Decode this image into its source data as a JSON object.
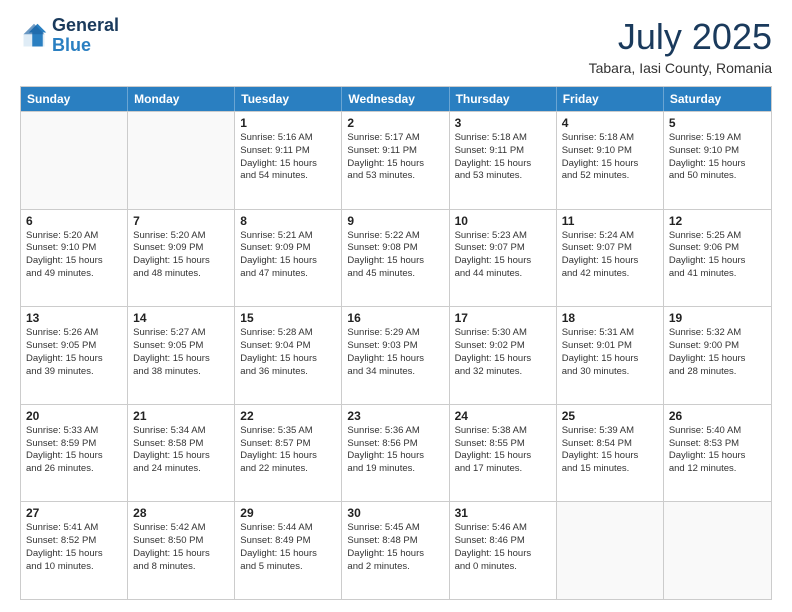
{
  "header": {
    "logo_general": "General",
    "logo_blue": "Blue",
    "month_title": "July 2025",
    "location": "Tabara, Iasi County, Romania"
  },
  "calendar": {
    "days_of_week": [
      "Sunday",
      "Monday",
      "Tuesday",
      "Wednesday",
      "Thursday",
      "Friday",
      "Saturday"
    ],
    "rows": [
      [
        {
          "day": "",
          "empty": true
        },
        {
          "day": "",
          "empty": true
        },
        {
          "day": "1",
          "line1": "Sunrise: 5:16 AM",
          "line2": "Sunset: 9:11 PM",
          "line3": "Daylight: 15 hours",
          "line4": "and 54 minutes."
        },
        {
          "day": "2",
          "line1": "Sunrise: 5:17 AM",
          "line2": "Sunset: 9:11 PM",
          "line3": "Daylight: 15 hours",
          "line4": "and 53 minutes."
        },
        {
          "day": "3",
          "line1": "Sunrise: 5:18 AM",
          "line2": "Sunset: 9:11 PM",
          "line3": "Daylight: 15 hours",
          "line4": "and 53 minutes."
        },
        {
          "day": "4",
          "line1": "Sunrise: 5:18 AM",
          "line2": "Sunset: 9:10 PM",
          "line3": "Daylight: 15 hours",
          "line4": "and 52 minutes."
        },
        {
          "day": "5",
          "line1": "Sunrise: 5:19 AM",
          "line2": "Sunset: 9:10 PM",
          "line3": "Daylight: 15 hours",
          "line4": "and 50 minutes."
        }
      ],
      [
        {
          "day": "6",
          "line1": "Sunrise: 5:20 AM",
          "line2": "Sunset: 9:10 PM",
          "line3": "Daylight: 15 hours",
          "line4": "and 49 minutes."
        },
        {
          "day": "7",
          "line1": "Sunrise: 5:20 AM",
          "line2": "Sunset: 9:09 PM",
          "line3": "Daylight: 15 hours",
          "line4": "and 48 minutes."
        },
        {
          "day": "8",
          "line1": "Sunrise: 5:21 AM",
          "line2": "Sunset: 9:09 PM",
          "line3": "Daylight: 15 hours",
          "line4": "and 47 minutes."
        },
        {
          "day": "9",
          "line1": "Sunrise: 5:22 AM",
          "line2": "Sunset: 9:08 PM",
          "line3": "Daylight: 15 hours",
          "line4": "and 45 minutes."
        },
        {
          "day": "10",
          "line1": "Sunrise: 5:23 AM",
          "line2": "Sunset: 9:07 PM",
          "line3": "Daylight: 15 hours",
          "line4": "and 44 minutes."
        },
        {
          "day": "11",
          "line1": "Sunrise: 5:24 AM",
          "line2": "Sunset: 9:07 PM",
          "line3": "Daylight: 15 hours",
          "line4": "and 42 minutes."
        },
        {
          "day": "12",
          "line1": "Sunrise: 5:25 AM",
          "line2": "Sunset: 9:06 PM",
          "line3": "Daylight: 15 hours",
          "line4": "and 41 minutes."
        }
      ],
      [
        {
          "day": "13",
          "line1": "Sunrise: 5:26 AM",
          "line2": "Sunset: 9:05 PM",
          "line3": "Daylight: 15 hours",
          "line4": "and 39 minutes."
        },
        {
          "day": "14",
          "line1": "Sunrise: 5:27 AM",
          "line2": "Sunset: 9:05 PM",
          "line3": "Daylight: 15 hours",
          "line4": "and 38 minutes."
        },
        {
          "day": "15",
          "line1": "Sunrise: 5:28 AM",
          "line2": "Sunset: 9:04 PM",
          "line3": "Daylight: 15 hours",
          "line4": "and 36 minutes."
        },
        {
          "day": "16",
          "line1": "Sunrise: 5:29 AM",
          "line2": "Sunset: 9:03 PM",
          "line3": "Daylight: 15 hours",
          "line4": "and 34 minutes."
        },
        {
          "day": "17",
          "line1": "Sunrise: 5:30 AM",
          "line2": "Sunset: 9:02 PM",
          "line3": "Daylight: 15 hours",
          "line4": "and 32 minutes."
        },
        {
          "day": "18",
          "line1": "Sunrise: 5:31 AM",
          "line2": "Sunset: 9:01 PM",
          "line3": "Daylight: 15 hours",
          "line4": "and 30 minutes."
        },
        {
          "day": "19",
          "line1": "Sunrise: 5:32 AM",
          "line2": "Sunset: 9:00 PM",
          "line3": "Daylight: 15 hours",
          "line4": "and 28 minutes."
        }
      ],
      [
        {
          "day": "20",
          "line1": "Sunrise: 5:33 AM",
          "line2": "Sunset: 8:59 PM",
          "line3": "Daylight: 15 hours",
          "line4": "and 26 minutes."
        },
        {
          "day": "21",
          "line1": "Sunrise: 5:34 AM",
          "line2": "Sunset: 8:58 PM",
          "line3": "Daylight: 15 hours",
          "line4": "and 24 minutes."
        },
        {
          "day": "22",
          "line1": "Sunrise: 5:35 AM",
          "line2": "Sunset: 8:57 PM",
          "line3": "Daylight: 15 hours",
          "line4": "and 22 minutes."
        },
        {
          "day": "23",
          "line1": "Sunrise: 5:36 AM",
          "line2": "Sunset: 8:56 PM",
          "line3": "Daylight: 15 hours",
          "line4": "and 19 minutes."
        },
        {
          "day": "24",
          "line1": "Sunrise: 5:38 AM",
          "line2": "Sunset: 8:55 PM",
          "line3": "Daylight: 15 hours",
          "line4": "and 17 minutes."
        },
        {
          "day": "25",
          "line1": "Sunrise: 5:39 AM",
          "line2": "Sunset: 8:54 PM",
          "line3": "Daylight: 15 hours",
          "line4": "and 15 minutes."
        },
        {
          "day": "26",
          "line1": "Sunrise: 5:40 AM",
          "line2": "Sunset: 8:53 PM",
          "line3": "Daylight: 15 hours",
          "line4": "and 12 minutes."
        }
      ],
      [
        {
          "day": "27",
          "line1": "Sunrise: 5:41 AM",
          "line2": "Sunset: 8:52 PM",
          "line3": "Daylight: 15 hours",
          "line4": "and 10 minutes."
        },
        {
          "day": "28",
          "line1": "Sunrise: 5:42 AM",
          "line2": "Sunset: 8:50 PM",
          "line3": "Daylight: 15 hours",
          "line4": "and 8 minutes."
        },
        {
          "day": "29",
          "line1": "Sunrise: 5:44 AM",
          "line2": "Sunset: 8:49 PM",
          "line3": "Daylight: 15 hours",
          "line4": "and 5 minutes."
        },
        {
          "day": "30",
          "line1": "Sunrise: 5:45 AM",
          "line2": "Sunset: 8:48 PM",
          "line3": "Daylight: 15 hours",
          "line4": "and 2 minutes."
        },
        {
          "day": "31",
          "line1": "Sunrise: 5:46 AM",
          "line2": "Sunset: 8:46 PM",
          "line3": "Daylight: 15 hours",
          "line4": "and 0 minutes."
        },
        {
          "day": "",
          "empty": true
        },
        {
          "day": "",
          "empty": true
        }
      ]
    ]
  }
}
